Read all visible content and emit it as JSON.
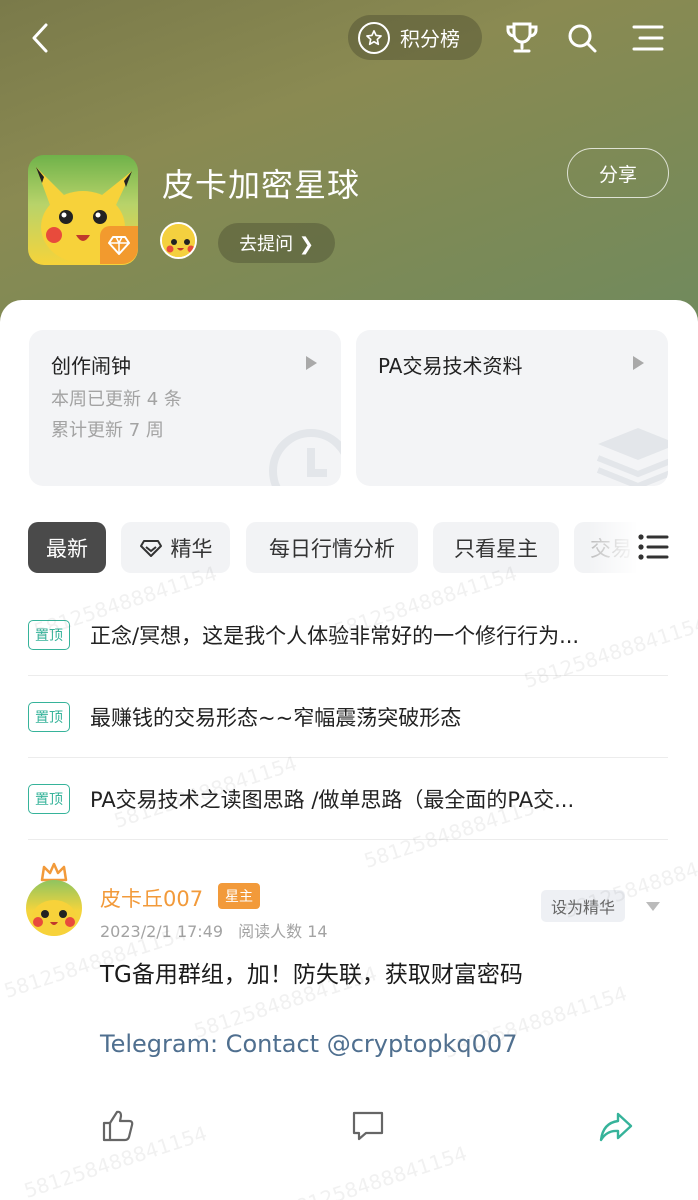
{
  "header": {
    "rank_label": "积分榜",
    "group_title": "皮卡加密星球",
    "share_label": "分享",
    "ask_label": "去提问 ❯"
  },
  "cards": [
    {
      "title": "创作闹钟",
      "lines": [
        "本周已更新 4 条",
        "累计更新 7 周"
      ]
    },
    {
      "title": "PA交易技术资料",
      "lines": []
    }
  ],
  "tabs": [
    "最新",
    "精华",
    "每日行情分析",
    "只看星主",
    "交易"
  ],
  "pinned": [
    {
      "tag": "置顶",
      "text": "正念/冥想，这是我个人体验非常好的一个修行行为..."
    },
    {
      "tag": "置顶",
      "text": "最赚钱的交易形态~~窄幅震荡突破形态"
    },
    {
      "tag": "置顶",
      "text": "PA交易技术之读图思路 /做单思路（最全面的PA交..."
    }
  ],
  "post": {
    "author": "皮卡丘007",
    "owner_tag": "星主",
    "date": "2023/2/1 17:49",
    "readers": "阅读人数 14",
    "featured_label": "设为精华",
    "body": "TG备用群组，加！防失联，获取财富密码",
    "link": "Telegram: Contact @cryptopkq007"
  },
  "watermark": "581258488841154",
  "colors": {
    "accent_green": "#36b39a",
    "author_orange": "#f29a3a",
    "link_blue": "#4f6f8f",
    "header_olive": "#7f8a55"
  }
}
